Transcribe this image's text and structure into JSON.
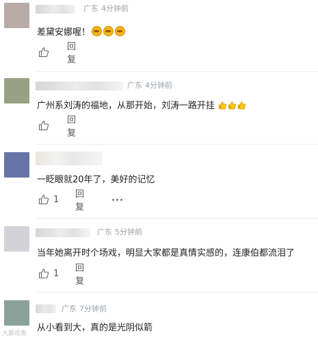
{
  "comments": [
    {
      "location": "广东",
      "time": "4分钟前",
      "text": "差黛安娜喔！",
      "emoji_count": 3,
      "reply_label": "回复",
      "avatar_color": "#b8aba6"
    },
    {
      "location": "广东",
      "time": "4分钟前",
      "text": "广州系刘涛的福地，从那开始，刘涛一路开挂",
      "emoji_count": 3,
      "reply_label": "回复",
      "avatar_color": "#9aa084"
    },
    {
      "location": "",
      "time": "",
      "text": "一眨眼就20年了，美好的记忆",
      "like_count": "1",
      "reply_label": "回复",
      "avatar_color": "#6674a6"
    },
    {
      "location": "广东",
      "time": "5分钟前",
      "text": "当年她离开时个场戏，明显大家都是真情实感的，连康伯都流泪了",
      "like_count": "1",
      "reply_label": "回复",
      "avatar_color": "#d2d2d8"
    },
    {
      "location": "广东",
      "time": "7分钟前",
      "text": "从小看到大，真的是光阴似箭",
      "avatar_color": "#8aa39a"
    }
  ],
  "watermark": "大鹏视角"
}
